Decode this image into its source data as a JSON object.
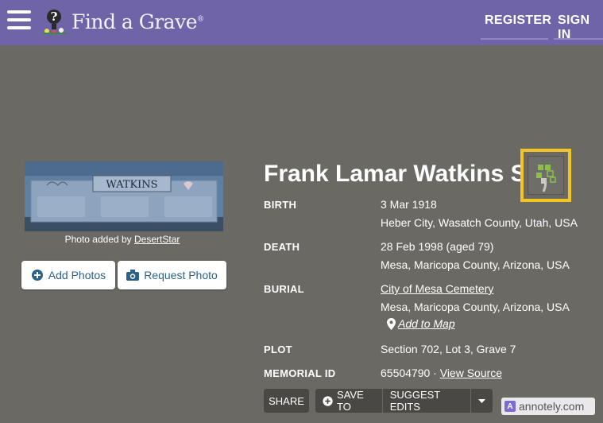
{
  "header": {
    "logo_text": "Find a Grave",
    "logo_registered": "®",
    "register_label": "REGISTER",
    "signin_label": "SIGN IN",
    "brand_color": "#6f64a8"
  },
  "photo": {
    "headstone_surname": "WATKINS",
    "caption_prefix": "Photo added by ",
    "caption_author": "DesertStar",
    "add_photos_label": "Add Photos",
    "request_photo_label": "Request Photo"
  },
  "memorial": {
    "name": "Frank Lamar Watkins Sr",
    "birth_label": "BIRTH",
    "birth_date": "3 Mar 1918",
    "birth_place": "Heber City, Wasatch County, Utah, USA",
    "death_label": "DEATH",
    "death_date": "28 Feb 1998 (aged 79)",
    "death_place": "Mesa, Maricopa County, Arizona, USA",
    "burial_label": "BURIAL",
    "burial_cemetery": "City of Mesa Cemetery",
    "burial_place": "Mesa, Maricopa County, Arizona, USA",
    "add_to_map": "Add to Map",
    "plot_label": "PLOT",
    "plot_value": "Section 702, Lot 3, Grave 7",
    "memorial_id_label": "MEMORIAL ID",
    "memorial_id": "65504790 ·",
    "view_source": "View Source"
  },
  "actions": {
    "share": "SHARE",
    "save_to": "SAVE TO",
    "suggest_edits": "SUGGEST EDITS"
  },
  "watermark": {
    "text": "annotely.com",
    "icon_letter": "A"
  },
  "icons": [
    "hamburger-icon",
    "plus-circle-icon",
    "camera-icon",
    "map-pin-icon",
    "family-tree-icon",
    "caret-down-icon"
  ]
}
